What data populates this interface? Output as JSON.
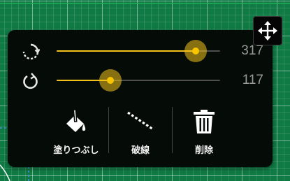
{
  "sliders": [
    {
      "icon": "rotate-dashed-icon",
      "value": "317",
      "fraction": 0.85
    },
    {
      "icon": "rotate-cw-icon",
      "value": "117",
      "fraction": 0.33
    }
  ],
  "actions": [
    {
      "label": "塗りつぶし",
      "icon": "paint-bucket-icon"
    },
    {
      "label": "破線",
      "icon": "dashed-line-icon"
    },
    {
      "label": "削除",
      "icon": "trash-icon"
    }
  ],
  "colors": {
    "accent": "#f2c21b",
    "panel": "#050c08",
    "background": "#0f7a43"
  }
}
